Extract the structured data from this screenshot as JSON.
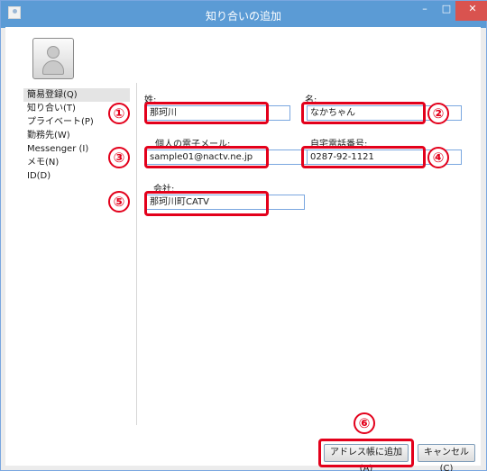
{
  "window": {
    "title": "知り合いの追加"
  },
  "titlebar_buttons": {
    "minimize": "–",
    "maximize": "□",
    "close": "✕"
  },
  "sidebar": {
    "items": [
      {
        "label": "簡易登録(Q)"
      },
      {
        "label": "知り合い(T)"
      },
      {
        "label": "プライベート(P)"
      },
      {
        "label": "勤務先(W)"
      },
      {
        "label": "Messenger (I)"
      },
      {
        "label": "メモ(N)"
      },
      {
        "label": "ID(D)"
      }
    ]
  },
  "form": {
    "last_name": {
      "label": "姓:",
      "value": "那珂川"
    },
    "first_name": {
      "label": "名:",
      "value": "なかちゃん"
    },
    "email": {
      "label": "個人の電子メール:",
      "value": "sample01@nactv.ne.jp"
    },
    "home_phone": {
      "label": "自宅電話番号:",
      "value": "0287-92-1121"
    },
    "company": {
      "label": "会社:",
      "value": "那珂川町CATV"
    }
  },
  "annotations": {
    "b1": "①",
    "b2": "②",
    "b3": "③",
    "b4": "④",
    "b5": "⑤",
    "b6": "⑥"
  },
  "buttons": {
    "add": "アドレス帳に追加(A)",
    "cancel": "キャンセル(C)"
  },
  "colors": {
    "titlebar": "#5b9bd5",
    "close_button": "#d9534f",
    "annotation_red": "#e3001b",
    "input_border": "#7aa7e0"
  }
}
